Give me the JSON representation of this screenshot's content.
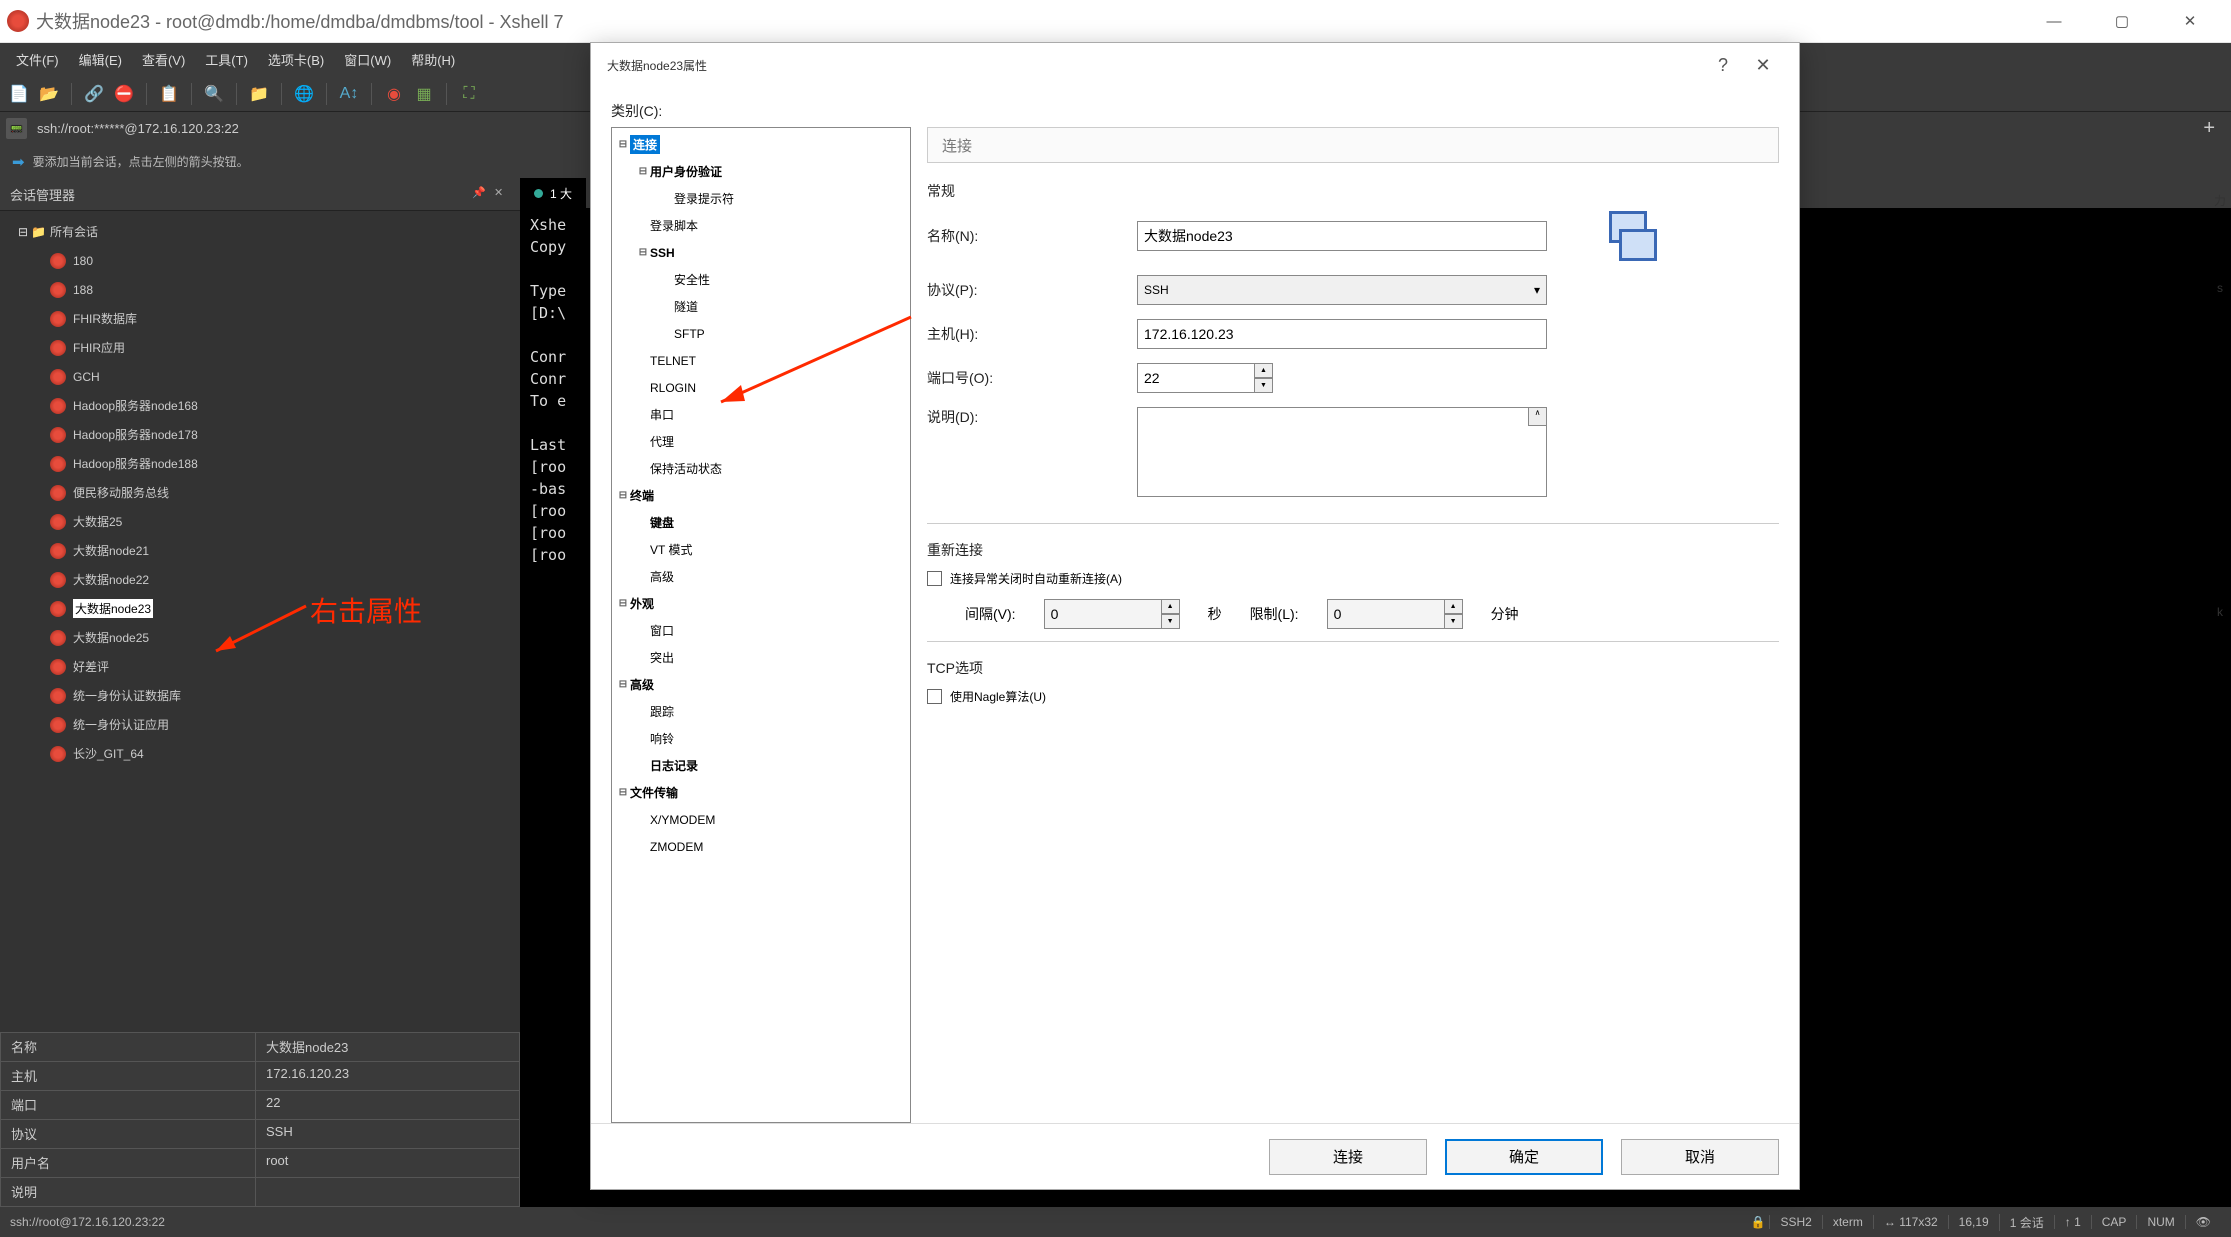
{
  "window": {
    "title": "大数据node23 - root@dmdb:/home/dmdba/dmdbms/tool - Xshell 7",
    "min": "—",
    "max": "▢",
    "close": "✕"
  },
  "menus": [
    "文件(F)",
    "编辑(E)",
    "查看(V)",
    "工具(T)",
    "选项卡(B)",
    "窗口(W)",
    "帮助(H)"
  ],
  "address": {
    "label": "📟",
    "text": "ssh://root:******@172.16.120.23:22",
    "plus": "+"
  },
  "hint": "要添加当前会话，点击左侧的箭头按钮。",
  "sessions": {
    "title": "会话管理器",
    "root": "所有会话",
    "items": [
      {
        "label": "180"
      },
      {
        "label": "188"
      },
      {
        "label": "FHIR数据库"
      },
      {
        "label": "FHIR应用"
      },
      {
        "label": "GCH"
      },
      {
        "label": "Hadoop服务器node168"
      },
      {
        "label": "Hadoop服务器node178"
      },
      {
        "label": "Hadoop服务器node188"
      },
      {
        "label": "便民移动服务总线"
      },
      {
        "label": "大数据25"
      },
      {
        "label": "大数据node21"
      },
      {
        "label": "大数据node22"
      },
      {
        "label": "大数据node23",
        "selected": true
      },
      {
        "label": "大数据node25"
      },
      {
        "label": "好差评"
      },
      {
        "label": "统一身份认证数据库"
      },
      {
        "label": "统一身份认证应用"
      },
      {
        "label": "长沙_GIT_64"
      }
    ]
  },
  "annotation_text": "右击属性",
  "props": [
    {
      "k": "名称",
      "v": "大数据node23"
    },
    {
      "k": "主机",
      "v": "172.16.120.23"
    },
    {
      "k": "端口",
      "v": "22"
    },
    {
      "k": "协议",
      "v": "SSH"
    },
    {
      "k": "用户名",
      "v": "root"
    },
    {
      "k": "说明",
      "v": ""
    }
  ],
  "tab": "1 大",
  "terminal": "Xshe\nCopy\n\nType\n[D:\\\n\nConr\nConr\nTo e\n\nLast\n[roo\n-bas\n[roo\n[roo\n[roo",
  "dialog": {
    "title": "大数据node23属性",
    "help": "?",
    "close": "✕",
    "category_label": "类别(C):",
    "tree": [
      {
        "label": "连接",
        "lvl": 0,
        "bold": true,
        "selected": true,
        "exp": "⊟"
      },
      {
        "label": "用户身份验证",
        "lvl": 1,
        "bold": true,
        "exp": "⊟"
      },
      {
        "label": "登录提示符",
        "lvl": 2
      },
      {
        "label": "登录脚本",
        "lvl": 1
      },
      {
        "label": "SSH",
        "lvl": 1,
        "bold": true,
        "exp": "⊟"
      },
      {
        "label": "安全性",
        "lvl": 2
      },
      {
        "label": "隧道",
        "lvl": 2
      },
      {
        "label": "SFTP",
        "lvl": 2
      },
      {
        "label": "TELNET",
        "lvl": 1
      },
      {
        "label": "RLOGIN",
        "lvl": 1
      },
      {
        "label": "串口",
        "lvl": 1
      },
      {
        "label": "代理",
        "lvl": 1
      },
      {
        "label": "保持活动状态",
        "lvl": 1
      },
      {
        "label": "终端",
        "lvl": 0,
        "bold": true,
        "exp": "⊟"
      },
      {
        "label": "键盘",
        "lvl": 1,
        "bold": true
      },
      {
        "label": "VT 模式",
        "lvl": 1
      },
      {
        "label": "高级",
        "lvl": 1
      },
      {
        "label": "外观",
        "lvl": 0,
        "bold": true,
        "exp": "⊟"
      },
      {
        "label": "窗口",
        "lvl": 1
      },
      {
        "label": "突出",
        "lvl": 1
      },
      {
        "label": "高级",
        "lvl": 0,
        "bold": true,
        "exp": "⊟"
      },
      {
        "label": "跟踪",
        "lvl": 1
      },
      {
        "label": "响铃",
        "lvl": 1
      },
      {
        "label": "日志记录",
        "lvl": 1,
        "bold": true
      },
      {
        "label": "文件传输",
        "lvl": 0,
        "bold": true,
        "exp": "⊟"
      },
      {
        "label": "X/YMODEM",
        "lvl": 1
      },
      {
        "label": "ZMODEM",
        "lvl": 1
      }
    ],
    "form": {
      "header": "连接",
      "group_general": "常规",
      "name_label": "名称(N):",
      "name_value": "大数据node23",
      "proto_label": "协议(P):",
      "proto_value": "SSH",
      "host_label": "主机(H):",
      "host_value": "172.16.120.23",
      "port_label": "端口号(O):",
      "port_value": "22",
      "desc_label": "说明(D):",
      "desc_value": "",
      "group_reconnect": "重新连接",
      "reconnect_chk": "连接异常关闭时自动重新连接(A)",
      "interval_label": "间隔(V):",
      "interval_value": "0",
      "interval_unit": "秒",
      "limit_label": "限制(L):",
      "limit_value": "0",
      "limit_unit": "分钟",
      "group_tcp": "TCP选项",
      "nagle_chk": "使用Nagle算法(U)"
    },
    "buttons": {
      "connect": "连接",
      "ok": "确定",
      "cancel": "取消"
    }
  },
  "status": {
    "left": "ssh://root@172.16.120.23:22",
    "ssh": "SSH2",
    "term": "xterm",
    "size": "117x32",
    "pos": "16,19",
    "sess": "1 会话",
    "num": "1",
    "cap": "CAP",
    "numlock": "NUM"
  }
}
